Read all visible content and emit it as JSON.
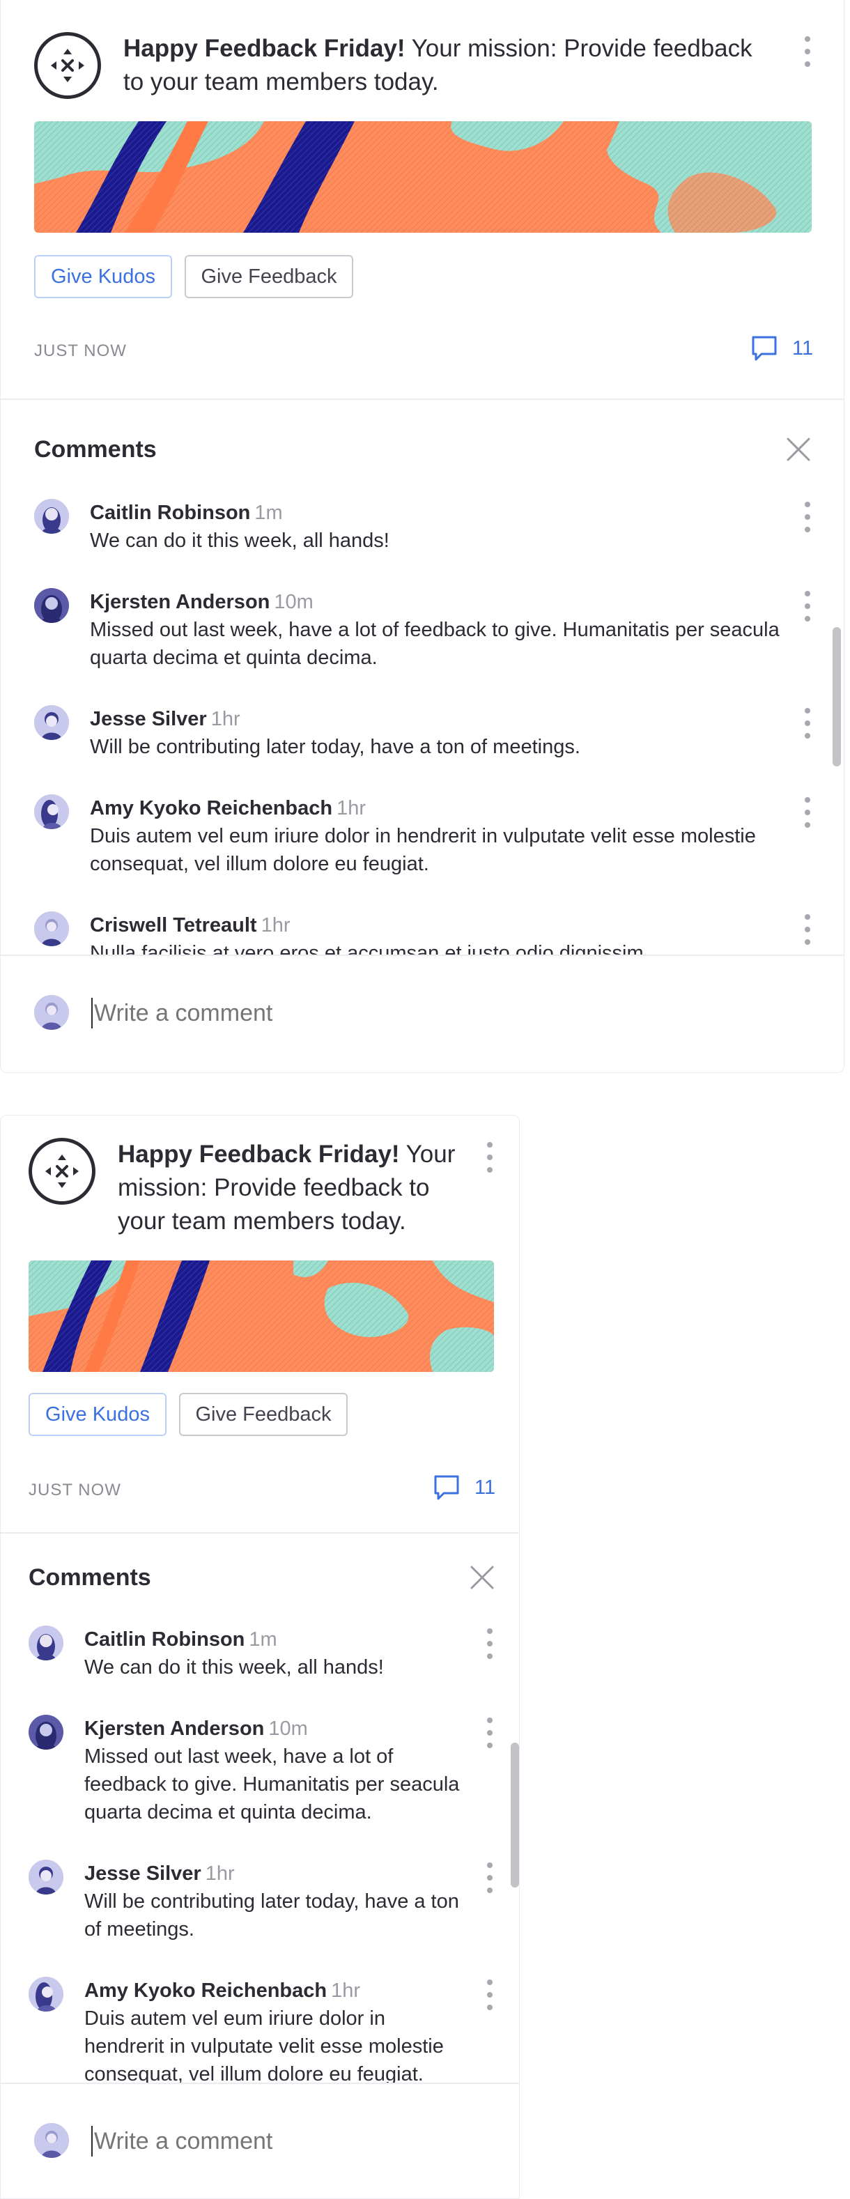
{
  "post": {
    "title_bold": "Happy Feedback Friday!",
    "title_rest": "Your mission: Provide feedback to your team members today.",
    "icon": "compass-move-icon",
    "buttons": {
      "kudos": "Give Kudos",
      "feedback": "Give Feedback"
    },
    "timestamp": "JUST NOW",
    "comment_count": "11"
  },
  "comments_panel": {
    "title": "Comments",
    "composer_placeholder": "Write a comment"
  },
  "comments": [
    {
      "name": "Caitlin Robinson",
      "time": "1m",
      "text": "We can do it this week, all hands!"
    },
    {
      "name": "Kjersten Anderson",
      "time": "10m",
      "text": "Missed out last week, have a lot of feedback to give. Humanitatis per seacula quarta decima et quinta decima."
    },
    {
      "name": "Jesse Silver",
      "time": "1hr",
      "text": "Will be contributing later today, have a ton of meetings."
    },
    {
      "name": "Amy Kyoko Reichenbach",
      "time": "1hr",
      "text": "Duis autem vel eum iriure dolor in hendrerit in vulputate velit esse molestie consequat, vel illum dolore eu feugiat."
    },
    {
      "name": "Criswell Tetreault",
      "time": "1hr",
      "text": "Nulla facilisis at vero eros et accumsan et iusto odio dignissim."
    }
  ],
  "colors": {
    "accent": "#3a70e0",
    "banner_orange": "#ff8c5c",
    "banner_navy": "#1a1a8c",
    "banner_mint": "#9fdfd0"
  }
}
